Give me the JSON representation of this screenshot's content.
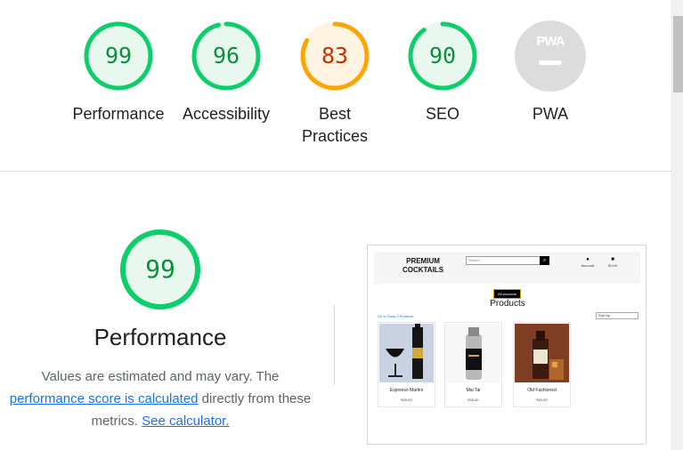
{
  "summary": {
    "items": [
      {
        "score": "99",
        "label": "Performance",
        "color": "#0cce6b",
        "text_color": "#0a8f3d",
        "fill": "#e9f8ef",
        "type": "score"
      },
      {
        "score": "96",
        "label": "Accessibility",
        "color": "#0cce6b",
        "text_color": "#0a8f3d",
        "fill": "#e9f8ef",
        "type": "score"
      },
      {
        "score": "83",
        "label": "Best Practices",
        "color": "#ffa400",
        "text_color": "#c33300",
        "fill": "#fff3e2",
        "type": "score"
      },
      {
        "score": "90",
        "label": "SEO",
        "color": "#0cce6b",
        "text_color": "#0a8f3d",
        "fill": "#e9f8ef",
        "type": "score"
      },
      {
        "score": "PWA",
        "label": "PWA",
        "color": "#dcdcdc",
        "text_color": "#ffffff",
        "fill": "#dcdcdc",
        "type": "pwa"
      }
    ]
  },
  "performance": {
    "score": "99",
    "title": "Performance",
    "desc_prefix": "Values are estimated and may vary. The ",
    "desc_link_1": "performance score is calculated",
    "desc_middle": " directly from these metrics. ",
    "desc_link_2": "See calculator.",
    "color": "#0cce6b",
    "text_color": "#0a8f3d",
    "fill": "#e9f8ef"
  },
  "preview": {
    "brand": "PREMIUM COCKTAILS",
    "search_placeholder": "Search",
    "account_label": "Account",
    "bag_label": "€0.00",
    "all_products_label": "All products",
    "title": "Products",
    "breadcrumb": "Go to Shop 3 Products",
    "sort_label": "Sort by...",
    "products": [
      {
        "name": "Espresso Martini",
        "price": "€25.00"
      },
      {
        "name": "Mai Tai",
        "price": "€25.00"
      },
      {
        "name": "Old Fashioned",
        "price": "€20.00"
      }
    ]
  }
}
